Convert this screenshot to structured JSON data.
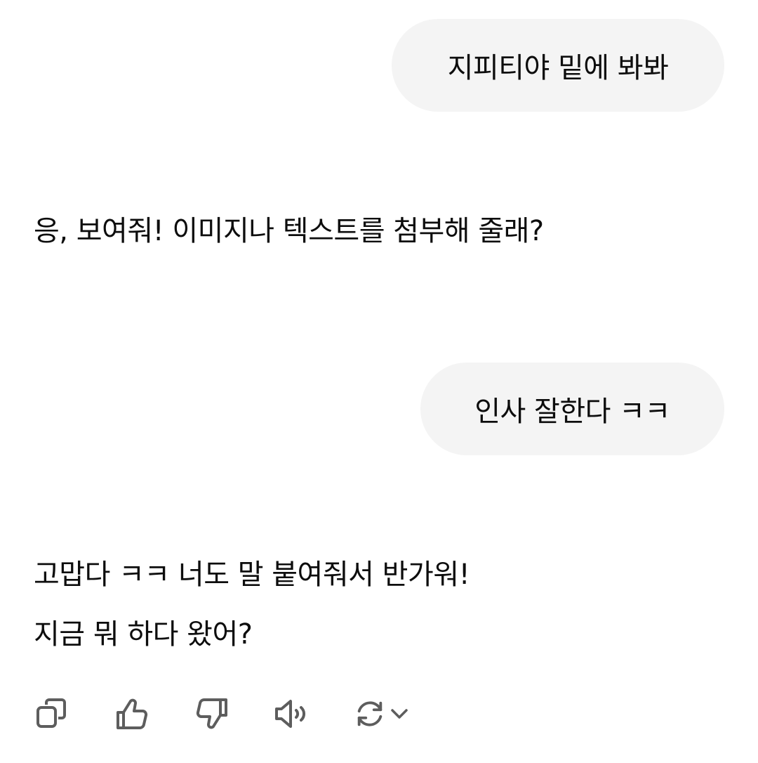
{
  "conversation": {
    "messages": [
      {
        "role": "user",
        "text": "지피티야 밑에 봐봐"
      },
      {
        "role": "assistant",
        "lines": [
          "응, 보여줘! 이미지나 텍스트를 첨부해 줄래?"
        ]
      },
      {
        "role": "user",
        "text": "인사 잘한다 ㅋㅋ"
      },
      {
        "role": "assistant",
        "lines": [
          "고맙다 ㅋㅋ 너도 말 붙여줘서 반가워!",
          "지금 뭐 하다 왔어?"
        ]
      }
    ]
  },
  "actions": {
    "icons": [
      "copy-icon",
      "thumbs-up-icon",
      "thumbs-down-icon",
      "speaker-icon",
      "regenerate-icon",
      "chevron-down-icon"
    ],
    "icon_color": "#5d5d5d"
  },
  "colors": {
    "user_bubble": "#f4f4f4",
    "text": "#0d0d0d",
    "background": "#ffffff"
  }
}
